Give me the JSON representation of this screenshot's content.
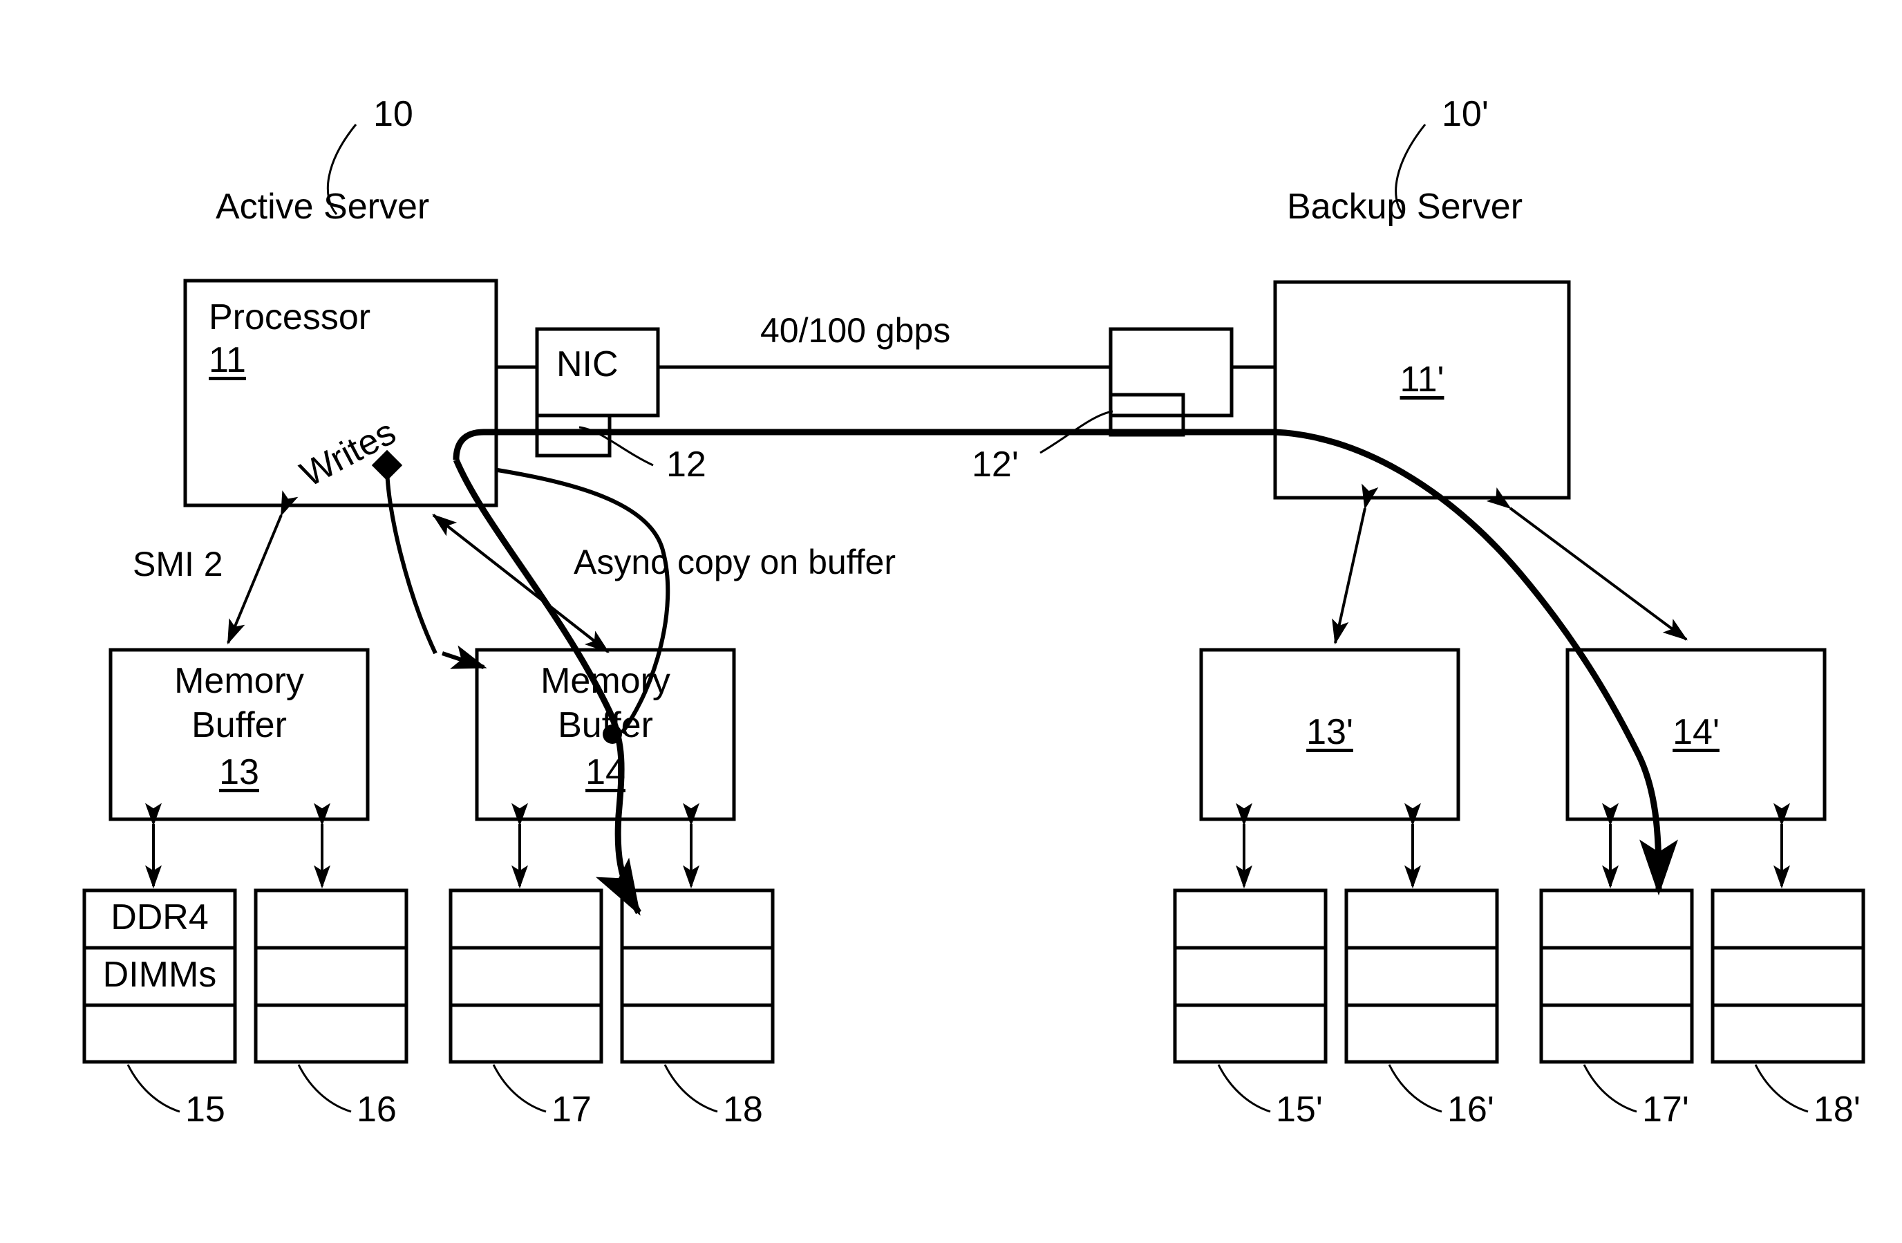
{
  "figure": {
    "active_server": {
      "title": "Active Server",
      "ref": "10",
      "processor": {
        "label": "Processor",
        "ref": "11"
      },
      "nic": {
        "label": "NIC",
        "ref": "12"
      },
      "buffers": [
        {
          "label_line1": "Memory",
          "label_line2": "Buffer",
          "ref": "13"
        },
        {
          "label_line1": "Memory",
          "label_line2": "Buffer",
          "ref": "14"
        }
      ],
      "dimms": [
        {
          "label_line1": "DDR4",
          "label_line2": "DIMMs",
          "ref": "15"
        },
        {
          "label_line1": "",
          "label_line2": "",
          "ref": "16"
        },
        {
          "label_line1": "",
          "label_line2": "",
          "ref": "17"
        },
        {
          "label_line1": "",
          "label_line2": "",
          "ref": "18"
        }
      ],
      "smi_label": "SMI 2",
      "writes_label": "Writes"
    },
    "backup_server": {
      "title": "Backup Server",
      "ref": "10'",
      "processor": {
        "label": "",
        "ref": "11'"
      },
      "nic": {
        "label": "",
        "ref": "12'"
      },
      "buffers": [
        {
          "label_line1": "",
          "label_line2": "",
          "ref": "13'"
        },
        {
          "label_line1": "",
          "label_line2": "",
          "ref": "14'"
        }
      ],
      "dimms": [
        {
          "label_line1": "",
          "label_line2": "",
          "ref": "15'"
        },
        {
          "label_line1": "",
          "label_line2": "",
          "ref": "16'"
        },
        {
          "label_line1": "",
          "label_line2": "",
          "ref": "17'"
        },
        {
          "label_line1": "",
          "label_line2": "",
          "ref": "18'"
        }
      ]
    },
    "link": {
      "speed_label": "40/100 gbps"
    },
    "async_label": "Async copy on buffer",
    "colors": {
      "stroke": "#000000",
      "background": "#ffffff"
    }
  }
}
